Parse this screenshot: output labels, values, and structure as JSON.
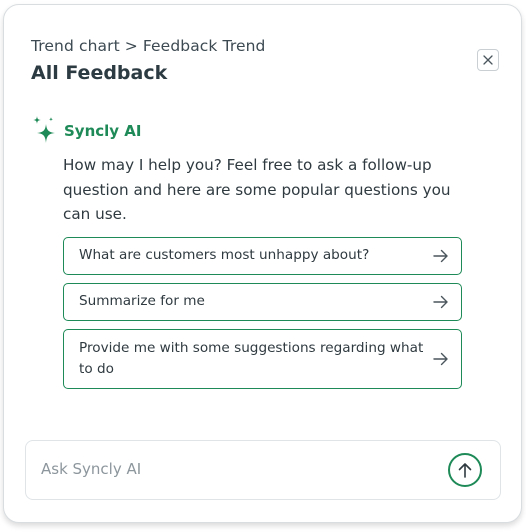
{
  "header": {
    "breadcrumb": "Trend chart > Feedback Trend",
    "title": "All Feedback",
    "close_icon": "close-icon"
  },
  "assistant": {
    "name": "Syncly AI",
    "icon": "sparkle-icon",
    "message": "How may I help you? Feel free to ask a follow-up question and here are some popular questions you can use."
  },
  "suggestions": [
    {
      "label": "What are customers most unhappy about?",
      "icon": "arrow-right-icon"
    },
    {
      "label": "Summarize for me",
      "icon": "arrow-right-icon"
    },
    {
      "label": "Provide me with some suggestions regarding what to do",
      "icon": "arrow-right-icon"
    }
  ],
  "chat_input": {
    "placeholder": "Ask Syncly AI",
    "value": "",
    "send_icon": "arrow-up-icon"
  },
  "colors": {
    "accent": "#1e8a57",
    "text": "#2f3a40",
    "border": "#d9dde0"
  }
}
